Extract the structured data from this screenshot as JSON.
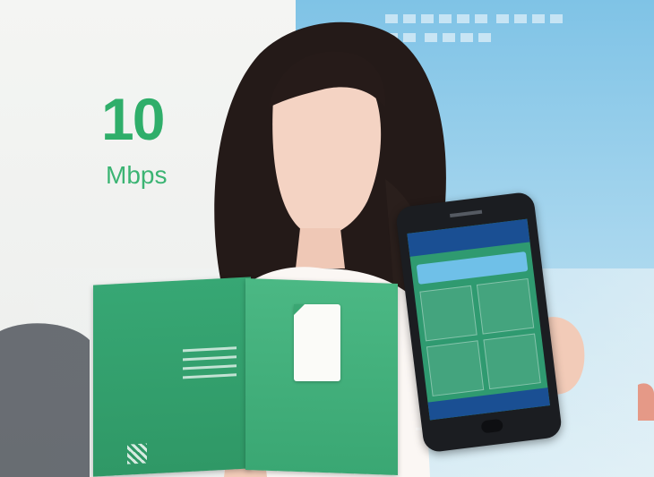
{
  "banner": {
    "number": "10",
    "unit": "Mbps"
  },
  "colors": {
    "brand_green": "#2fae6a",
    "backdrop_blue": "#7fc3e6",
    "phone_body": "#1b1d21",
    "screen_header": "#1a4f93"
  },
  "icons": {
    "sim_card": "sim-card-icon",
    "qr_code": "qr-code-icon"
  }
}
